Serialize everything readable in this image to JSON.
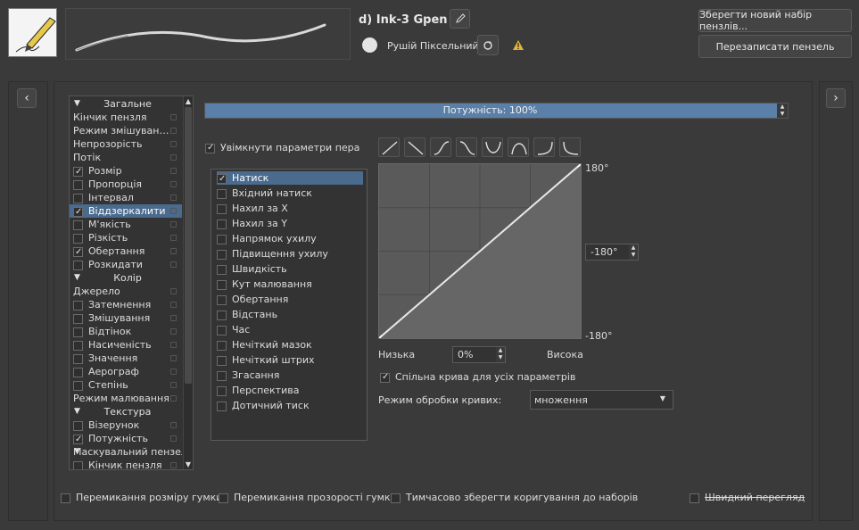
{
  "preset": {
    "name": "d) Ink-3 Gpen",
    "engine": "Рушій Піксельний",
    "save_new_label": "Зберегти новий набір пензлів...",
    "overwrite_label": "Перезаписати пензель"
  },
  "nav": {
    "left_arrow": "‹",
    "right_arrow": "›"
  },
  "option_list": {
    "items": [
      {
        "label": "Загальне",
        "type": "header"
      },
      {
        "label": "Кінчик пензля",
        "type": "plain"
      },
      {
        "label": "Режим змішуван…",
        "type": "plain"
      },
      {
        "label": "Непрозорість",
        "type": "plain"
      },
      {
        "label": "Потік",
        "type": "plain"
      },
      {
        "label": "Розмір",
        "type": "check",
        "checked": true
      },
      {
        "label": "Пропорція",
        "type": "check",
        "checked": false
      },
      {
        "label": "Інтервал",
        "type": "check",
        "checked": false
      },
      {
        "label": "Віддзеркалити",
        "type": "check",
        "checked": true,
        "selected": true
      },
      {
        "label": "М'якість",
        "type": "check",
        "checked": false
      },
      {
        "label": "Різкість",
        "type": "check",
        "checked": false
      },
      {
        "label": "Обертання",
        "type": "check",
        "checked": true
      },
      {
        "label": "Розкидати",
        "type": "check",
        "checked": false
      },
      {
        "label": "Колір",
        "type": "header"
      },
      {
        "label": "Джерело",
        "type": "plain"
      },
      {
        "label": "Затемнення",
        "type": "check",
        "checked": false
      },
      {
        "label": "Змішування",
        "type": "check",
        "checked": false
      },
      {
        "label": "Відтінок",
        "type": "check",
        "checked": false
      },
      {
        "label": "Насиченість",
        "type": "check",
        "checked": false
      },
      {
        "label": "Значення",
        "type": "check",
        "checked": false
      },
      {
        "label": "Аерограф",
        "type": "check",
        "checked": false
      },
      {
        "label": "Степінь",
        "type": "check",
        "checked": false
      },
      {
        "label": "Режим малювання",
        "type": "plain"
      },
      {
        "label": "Текстура",
        "type": "header"
      },
      {
        "label": "Візерунок",
        "type": "check",
        "checked": false
      },
      {
        "label": "Потужність",
        "type": "check",
        "checked": true
      },
      {
        "label": "Маскувальний пензель",
        "type": "header-left"
      },
      {
        "label": "Кінчик пензля",
        "type": "check",
        "checked": false
      }
    ]
  },
  "strength": {
    "label": "Потужність: 100%",
    "value": 1.0
  },
  "enable_pen": {
    "label": "Увімкнути параметри пера",
    "checked": true
  },
  "sensors": [
    {
      "label": "Натиск",
      "checked": true,
      "selected": true
    },
    {
      "label": "Вхідний натиск",
      "checked": false
    },
    {
      "label": "Нахил за X",
      "checked": false
    },
    {
      "label": "Нахил за Y",
      "checked": false
    },
    {
      "label": "Напрямок ухилу",
      "checked": false
    },
    {
      "label": "Підвищення ухилу",
      "checked": false
    },
    {
      "label": "Швидкість",
      "checked": false
    },
    {
      "label": "Кут малювання",
      "checked": false
    },
    {
      "label": "Обертання",
      "checked": false
    },
    {
      "label": "Відстань",
      "checked": false
    },
    {
      "label": "Час",
      "checked": false
    },
    {
      "label": "Нечіткий мазок",
      "checked": false
    },
    {
      "label": "Нечіткий штрих",
      "checked": false
    },
    {
      "label": "Згасання",
      "checked": false
    },
    {
      "label": "Перспектива",
      "checked": false
    },
    {
      "label": "Дотичний тиск",
      "checked": false
    }
  ],
  "curve": {
    "top_label": "180°",
    "spin_value": "-180°",
    "bottom_label": "-180°",
    "low_label": "Низька",
    "high_label": "Висока",
    "low_value": "0%",
    "points": [
      [
        0,
        0
      ],
      [
        1,
        1
      ]
    ]
  },
  "shared_curve": {
    "label": "Спільна крива для усіх параметрів",
    "checked": true
  },
  "curve_mode": {
    "label": "Режим обробки кривих:",
    "value": "множення"
  },
  "bottom": {
    "eraser_size": "Перемикання розміру гумки",
    "eraser_opacity": "Перемикання прозорості гумки",
    "temp_save": "Тимчасово зберегти коригування до наборів",
    "quick_preview": "Швидкий перегляд"
  },
  "colors": {
    "accent": "#4a6a8e",
    "bar": "#5a7fa8"
  }
}
